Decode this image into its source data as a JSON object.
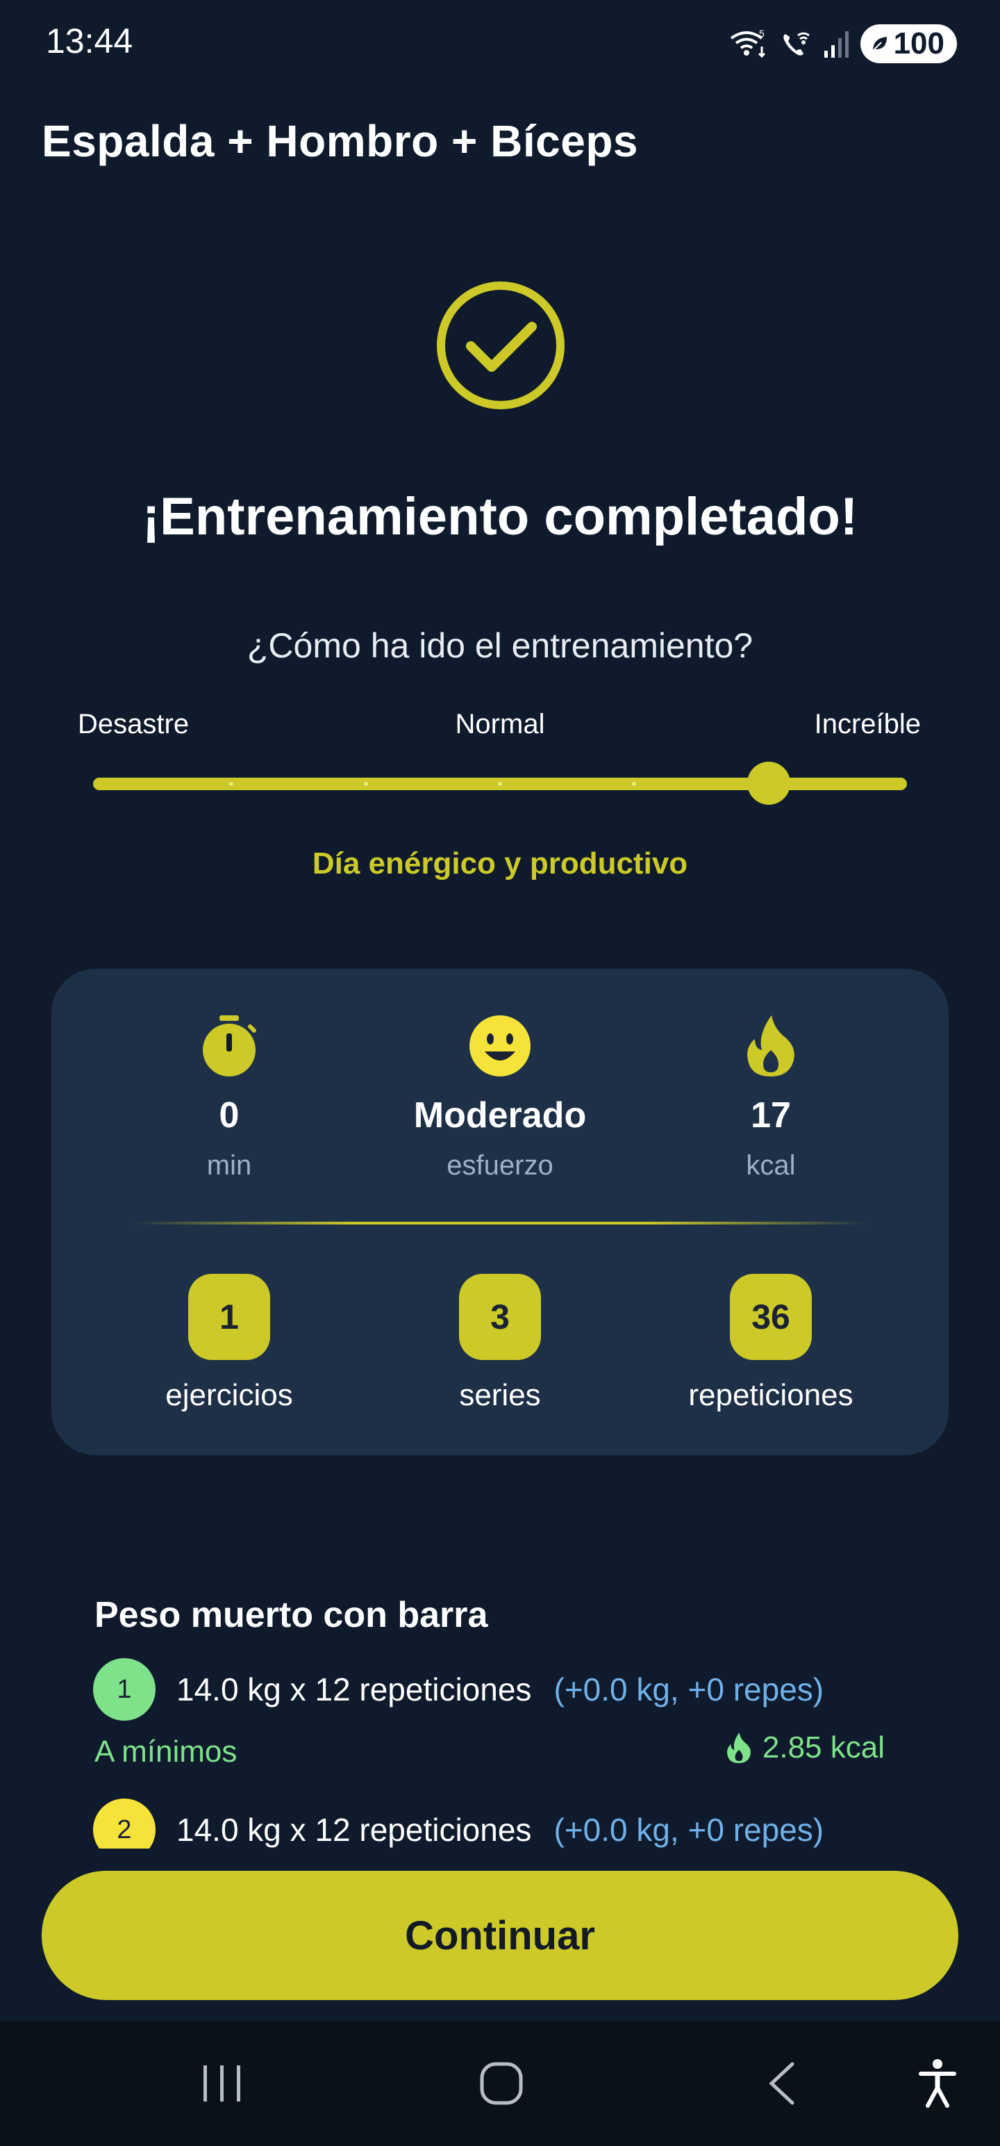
{
  "status_bar": {
    "time": "13:44",
    "battery": "100",
    "icons": [
      "wifi-calling-icon",
      "vowifi-icon",
      "signal-icon",
      "battery-icon"
    ]
  },
  "header": {
    "title": "Espalda + Hombro + Bíceps"
  },
  "completion": {
    "icon": "check-circle-icon",
    "headline": "¡Entrenamiento completado!"
  },
  "rating": {
    "question": "¿Cómo ha ido el entrenamiento?",
    "label_left": "Desastre",
    "label_mid": "Normal",
    "label_right": "Increíble",
    "value_fraction": 0.83,
    "mood_text": "Día enérgico y productivo"
  },
  "stats": {
    "duration": {
      "icon": "stopwatch-icon",
      "value": "0",
      "unit": "min"
    },
    "effort": {
      "icon": "smiley-face-icon",
      "value": "Moderado",
      "unit": "esfuerzo"
    },
    "calories": {
      "icon": "flame-icon",
      "value": "17",
      "unit": "kcal"
    },
    "exercises": {
      "value": "1",
      "label": "ejercicios"
    },
    "series": {
      "value": "3",
      "label": "series"
    },
    "reps": {
      "value": "36",
      "label": "repeticiones"
    }
  },
  "exercise": {
    "name": "Peso muerto con barra",
    "sets": [
      {
        "number": "1",
        "text": "14.0 kg x 12 repeticiones",
        "delta": "(+0.0 kg, +0 repes)",
        "badge_color": "#7ee28a"
      },
      {
        "number": "2",
        "text": "14.0 kg x 12 repeticiones",
        "delta": "(+0.0 kg, +0 repes)",
        "badge_color": "#f5e33a"
      }
    ],
    "intensity_label": "A mínimos",
    "kcal": "2.85 kcal"
  },
  "actions": {
    "continue_label": "Continuar"
  },
  "nav": [
    "recent-apps-icon",
    "home-icon",
    "back-icon",
    "accessibility-icon"
  ],
  "colors": {
    "background": "#0f1b2c",
    "accent": "#ccc928",
    "card": "#1e3048",
    "green": "#7ee28a",
    "blue": "#6fb1ea"
  }
}
